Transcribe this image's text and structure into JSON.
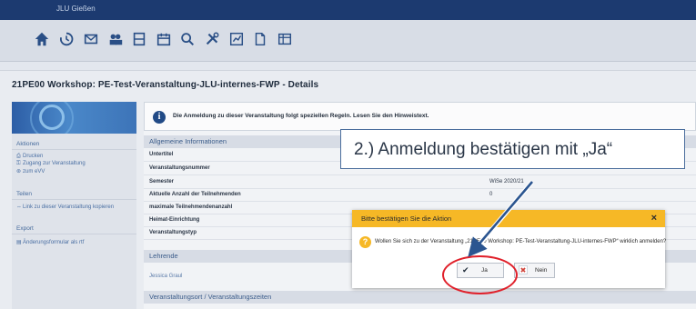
{
  "app": {
    "brand": "JLU Gießen"
  },
  "toolbar": {
    "icons": [
      "home-icon",
      "history-icon",
      "mail-icon",
      "users-icon",
      "book-icon",
      "calendar-icon",
      "search-icon",
      "tools-icon",
      "chart-icon",
      "document-icon",
      "grid-icon"
    ]
  },
  "page": {
    "title": "21PE00 Workshop: PE-Test-Veranstaltung-JLU-internes-FWP - Details"
  },
  "sidebar": {
    "aktionen": {
      "title": "Aktionen",
      "items": [
        "Drucken",
        "Zugang zur Veranstaltung",
        "zum eVV"
      ]
    },
    "teilen": {
      "title": "Teilen",
      "items": [
        "Link zu dieser Veranstaltung kopieren"
      ]
    },
    "export": {
      "title": "Export",
      "items": [
        "Änderungsformular als rtf"
      ]
    }
  },
  "info": {
    "text": "Die Anmeldung zu dieser Veranstaltung folgt speziellen Regeln. Lesen Sie den Hinweistext."
  },
  "allgemein": {
    "title": "Allgemeine Informationen",
    "fields": [
      {
        "label": "Untertitel",
        "value": ""
      },
      {
        "label": "Veranstaltungsnummer",
        "value": ""
      },
      {
        "label": "Semester",
        "value": "WiSe 2020/21"
      },
      {
        "label": "Aktuelle Anzahl der Teilnehmenden",
        "value": "0"
      },
      {
        "label": "maximale Teilnehmendenanzahl",
        "value": ""
      },
      {
        "label": "Heimat-Einrichtung",
        "value": ""
      },
      {
        "label": "Veranstaltungstyp",
        "value": ""
      }
    ]
  },
  "lehrende": {
    "title": "Lehrende",
    "name": "Jessica Graul"
  },
  "ort": {
    "title": "Veranstaltungsort / Veranstaltungszeiten"
  },
  "callout": {
    "text": "2.) Anmeldung bestätigen mit „Ja“"
  },
  "modal": {
    "title": "Bitte bestätigen Sie die Aktion",
    "message": "Wollen Sie sich zu der Veranstaltung „21PE00 Workshop: PE-Test-Veranstaltung-JLU-internes-FWP“ wirklich anmelden?",
    "yes_label": "Ja",
    "no_label": "Nein"
  },
  "colors": {
    "accent": "#1c3a70",
    "modal_header": "#f6b826",
    "highlight": "#e0202a"
  }
}
